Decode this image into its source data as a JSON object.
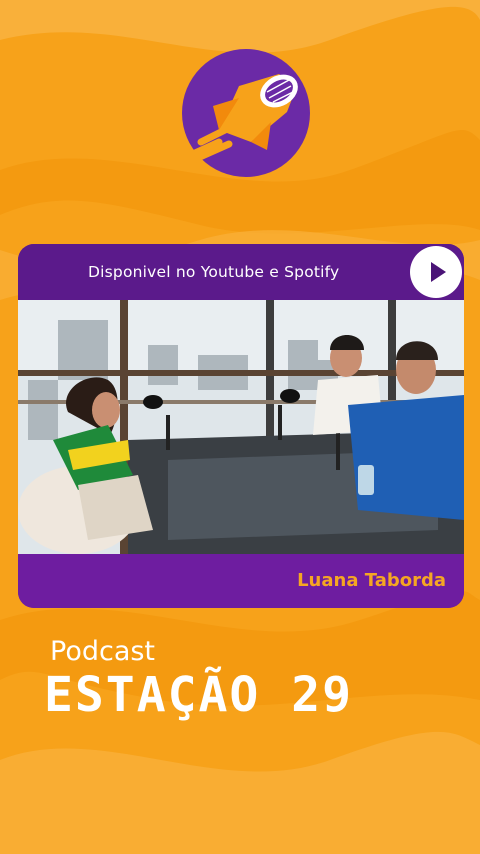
{
  "header": {
    "tagline": "Disponivel no Youtube e Spotify"
  },
  "guest": {
    "name": "Luana Taborda"
  },
  "footer": {
    "label": "Podcast",
    "title": "ESTAÇÃO 29"
  },
  "colors": {
    "background": "#f7a21a",
    "accent_purple": "#5b1a8b",
    "guest_text": "#f5a623"
  },
  "icons": [
    "rocket-microphone-logo-icon",
    "play-icon"
  ]
}
